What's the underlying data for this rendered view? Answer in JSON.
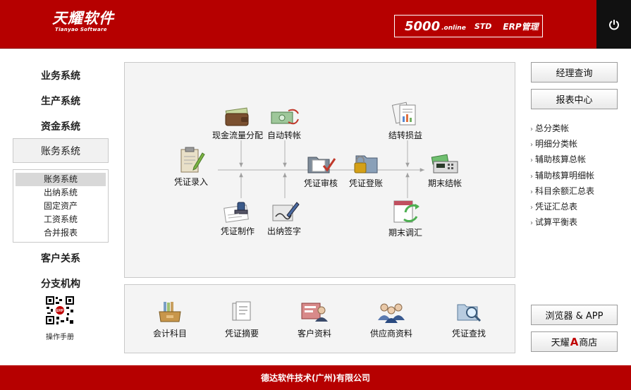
{
  "header": {
    "logo_cn": "天耀软件",
    "logo_en": "Tianyao Software",
    "product_num": "5000",
    "product_online": ".online",
    "product_std": "STD",
    "product_erp": "ERP管理"
  },
  "left_nav": {
    "items": [
      "业务系统",
      "生产系统",
      "资金系统",
      "账务系统",
      "客户关系",
      "分支机构"
    ],
    "sub_items": [
      "账务系统",
      "出纳系统",
      "固定资产",
      "工资系统",
      "合并报表"
    ],
    "qr_label": "操作手册"
  },
  "flow": {
    "voucher_entry": "凭证录入",
    "cash_flow": "现金流量分配",
    "auto_transfer": "自动转帐",
    "voucher_audit": "凭证审核",
    "voucher_post": "凭证登账",
    "transfer_pl": "结转损益",
    "period_close": "期末结帐",
    "voucher_make": "凭证制作",
    "cashier_sign": "出纳签字",
    "period_adjust": "期末调汇"
  },
  "tools": [
    "会计科目",
    "凭证摘要",
    "客户资料",
    "供应商资料",
    "凭证查找"
  ],
  "right": {
    "btn_manager": "经理查询",
    "btn_report": "报表中心",
    "links": [
      "总分类帐",
      "明细分类帐",
      "辅助核算总帐",
      "辅助核算明细帐",
      "科目余额汇总表",
      "凭证汇总表",
      "试算平衡表"
    ],
    "btn_browser": "浏览器 & APP",
    "btn_shop_pre": "天耀",
    "btn_shop_a": "A",
    "btn_shop_post": "商店"
  },
  "footer": {
    "company": "德达软件技术(广州)有限公司"
  }
}
